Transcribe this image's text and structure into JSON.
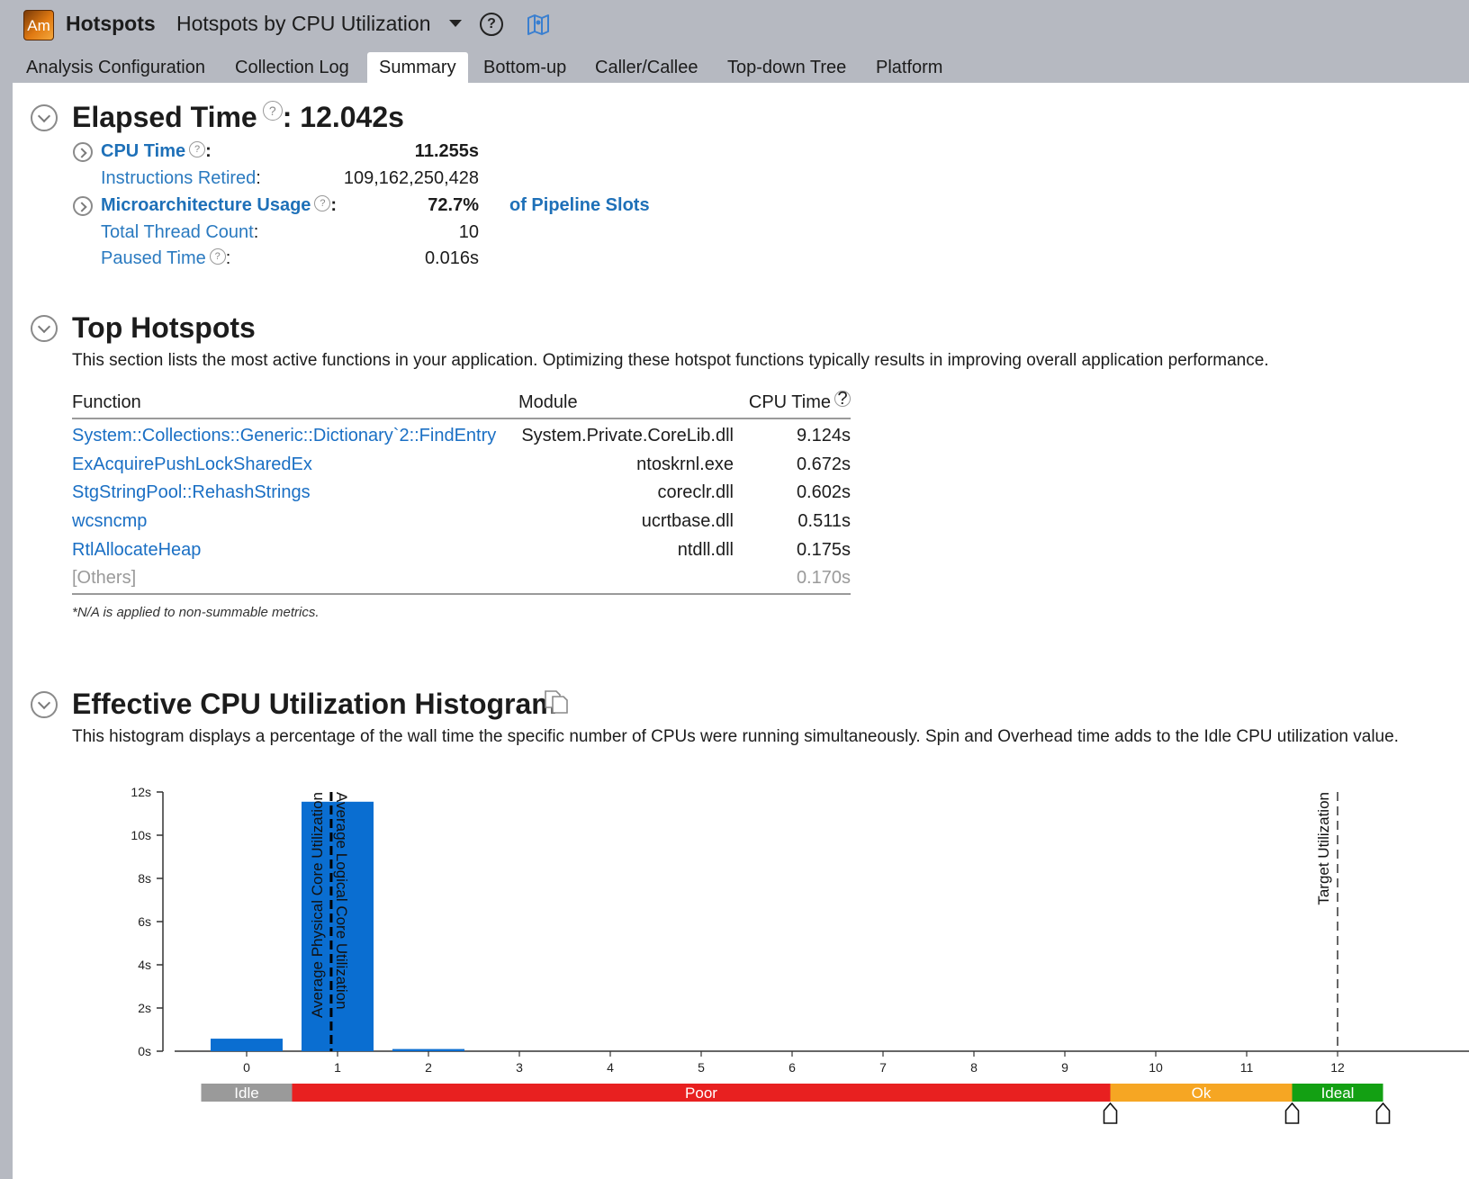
{
  "app": {
    "logo_text": "Am",
    "name": "Hotspots",
    "analysis": "Hotspots by CPU Utilization"
  },
  "tabs": [
    {
      "label": "Analysis Configuration"
    },
    {
      "label": "Collection Log"
    },
    {
      "label": "Summary",
      "active": true
    },
    {
      "label": "Bottom-up"
    },
    {
      "label": "Caller/Callee"
    },
    {
      "label": "Top-down Tree"
    },
    {
      "label": "Platform"
    }
  ],
  "elapsed": {
    "title": "Elapsed Time",
    "value": "12.042s",
    "metrics": {
      "cpu_time": {
        "label": "CPU Time",
        "value": "11.255s"
      },
      "instructions": {
        "label": "Instructions Retired",
        "value": "109,162,250,428"
      },
      "uarch": {
        "label": "Microarchitecture Usage",
        "value": "72.7%",
        "suffix": "of Pipeline Slots"
      },
      "threads": {
        "label": "Total Thread Count",
        "value": "10"
      },
      "paused": {
        "label": "Paused Time",
        "value": "0.016s"
      }
    }
  },
  "hotspots": {
    "title": "Top Hotspots",
    "description": "This section lists the most active functions in your application. Optimizing these hotspot functions typically results in improving overall application performance.",
    "columns": {
      "function": "Function",
      "module": "Module",
      "cpu": "CPU Time"
    },
    "rows": [
      {
        "function": "System::Collections::Generic::Dictionary`2::FindEntry",
        "module": "System.Private.CoreLib.dll",
        "cpu": "9.124s"
      },
      {
        "function": "ExAcquirePushLockSharedEx",
        "module": "ntoskrnl.exe",
        "cpu": "0.672s"
      },
      {
        "function": "StgStringPool::RehashStrings",
        "module": "coreclr.dll",
        "cpu": "0.602s"
      },
      {
        "function": "wcsncmp",
        "module": "ucrtbase.dll",
        "cpu": "0.511s"
      },
      {
        "function": "RtlAllocateHeap",
        "module": "ntdll.dll",
        "cpu": "0.175s"
      }
    ],
    "others": {
      "function": "[Others]",
      "cpu": "0.170s"
    },
    "footnote": "*N/A is applied to non-summable metrics."
  },
  "histogram": {
    "title": "Effective CPU Utilization Histogram",
    "description": "This histogram displays a percentage of the wall time the specific number of CPUs were running simultaneously. Spin and Overhead time adds to the Idle CPU utilization value."
  },
  "chart_data": {
    "type": "bar",
    "x": [
      0,
      1,
      2,
      3,
      4,
      5,
      6,
      7,
      8,
      9,
      10,
      11,
      12
    ],
    "values": [
      0.58,
      11.55,
      0.1,
      0,
      0,
      0,
      0,
      0,
      0,
      0,
      0,
      0,
      0
    ],
    "y_ticks": [
      "0s",
      "2s",
      "4s",
      "6s",
      "8s",
      "10s",
      "12s"
    ],
    "ylim": [
      0,
      12
    ],
    "bar_color": "#0a6ed1",
    "markers": [
      {
        "label": "Average Physical Core Utilization",
        "x": 0.93,
        "style": "dashed-bold"
      },
      {
        "label": "Average Logical Core Utilization",
        "x": 0.93,
        "style": "dashed-bold"
      },
      {
        "label": "Target Utilization",
        "x": 12,
        "style": "dashed"
      }
    ],
    "zones": [
      {
        "label": "Idle",
        "from": -0.5,
        "to": 0.5,
        "color": "#9a9a9a"
      },
      {
        "label": "Poor",
        "from": 0.5,
        "to": 9.5,
        "color": "#e82020"
      },
      {
        "label": "Ok",
        "from": 9.5,
        "to": 11.5,
        "color": "#f6a623"
      },
      {
        "label": "Ideal",
        "from": 11.5,
        "to": 12.5,
        "color": "#13a013"
      }
    ]
  }
}
